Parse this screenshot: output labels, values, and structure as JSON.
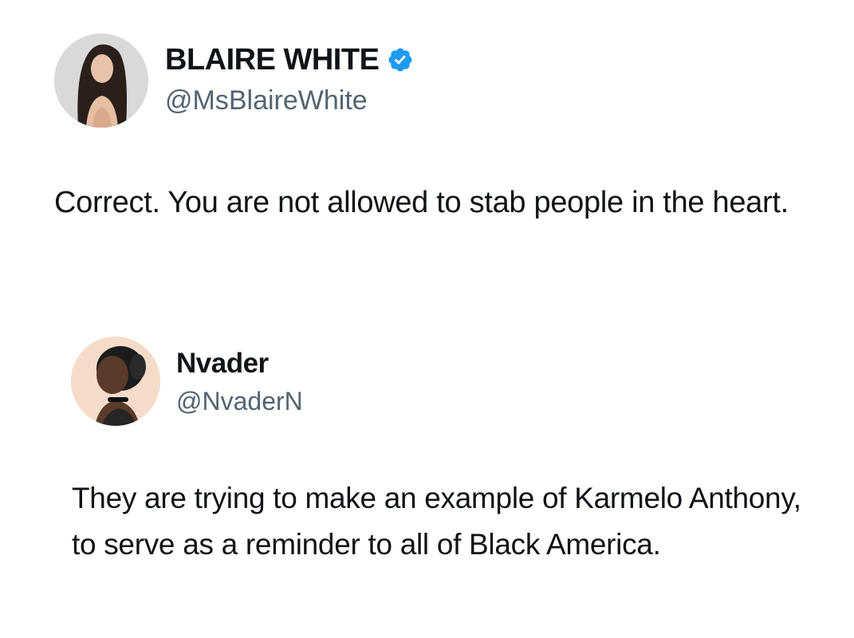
{
  "tweets": [
    {
      "display_name": "BLAIRE WHITE",
      "handle": "@MsBlaireWhite",
      "verified": true,
      "avatar_icon": "profile-photo",
      "text": "Correct. You are not allowed to stab people in the heart."
    },
    {
      "display_name": "Nvader",
      "handle": "@NvaderN",
      "verified": false,
      "avatar_icon": "profile-photo",
      "text": "They are trying to make an example of Karmelo Anthony, to serve as a reminder to all of Black America."
    }
  ],
  "colors": {
    "text": "#0f1419",
    "secondary_text": "#536471",
    "verified_badge": "#1d9bf0",
    "background": "#ffffff"
  }
}
